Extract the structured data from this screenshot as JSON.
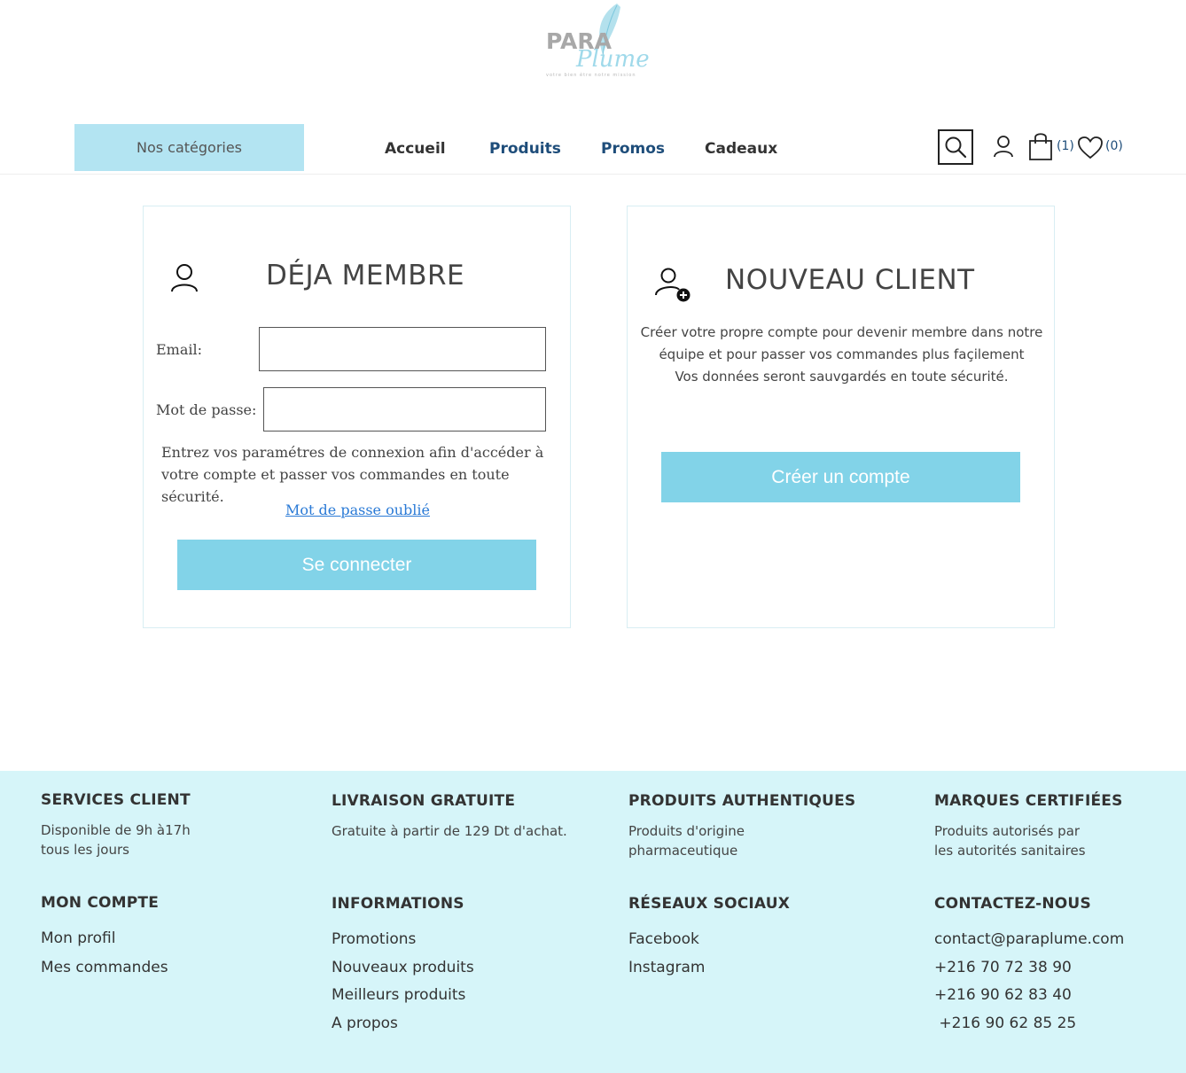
{
  "logo": {
    "brand_top": "PARA",
    "brand_script": "Plume",
    "tagline": "votre bien être notre mission"
  },
  "nav": {
    "categories_label": "Nos catégories",
    "links": [
      {
        "label": "Accueil"
      },
      {
        "label": "Produits"
      },
      {
        "label": "Promos"
      },
      {
        "label": "Cadeaux"
      }
    ],
    "cart_count": "(1)",
    "wishlist_count": "(0)"
  },
  "login": {
    "title": "DÉJA MEMBRE",
    "email_label": "Email:",
    "email_value": "",
    "password_label": "Mot de passe:",
    "password_value": "",
    "help_text": "Entrez vos paramétres de connexion afin d'accéder à votre compte et passer vos commandes en toute sécurité.",
    "forgot_label": "Mot de passe oublié",
    "submit_label": "Se connecter"
  },
  "register": {
    "title": "NOUVEAU CLIENT",
    "desc_line1": "Créer votre propre compte pour devenir membre dans notre",
    "desc_line2": "équipe et pour passer vos commandes plus façilement",
    "desc_line3": "Vos données seront sauvgardés en toute sécurité.",
    "button_label": "Créer un compte"
  },
  "footer": {
    "services": {
      "title": "SERVICES CLIENT",
      "line1": "Disponible de 9h à17h",
      "line2": "tous les jours"
    },
    "livraison": {
      "title": "LIVRAISON GRATUITE",
      "line1": "Gratuite à partir de 129 Dt d'achat."
    },
    "produits": {
      "title": "PRODUITS AUTHENTIQUES",
      "line1": "Produits d'origine",
      "line2": "pharmaceutique"
    },
    "marques": {
      "title": "MARQUES CERTIFIÉES",
      "line1": "Produits autorisés par",
      "line2": "les autorités sanitaires"
    },
    "compte": {
      "title": "MON COMPTE",
      "links": [
        "Mon profil",
        "Mes commandes"
      ]
    },
    "informations": {
      "title": "INFORMATIONS",
      "links": [
        "Promotions",
        "Nouveaux produits",
        "Meilleurs produits",
        "A propos"
      ]
    },
    "reseaux": {
      "title": "RÉSEAUX SOCIAUX",
      "links": [
        "Facebook",
        "Instagram"
      ]
    },
    "contact": {
      "title": "CONTACTEZ-NOUS",
      "links": [
        "contact@paraplume.com",
        "+216 70 72 38 90",
        "+216 90 62 83 40",
        " +216 90 62 85 25"
      ]
    }
  }
}
